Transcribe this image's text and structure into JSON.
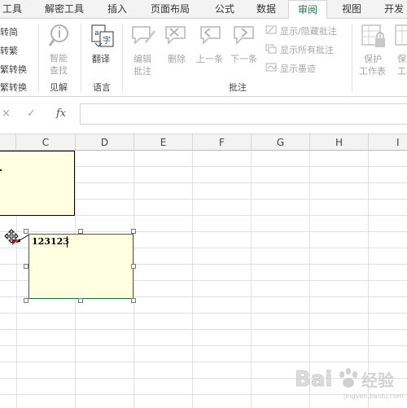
{
  "tabs": [
    {
      "label": "工具",
      "active": false
    },
    {
      "label": "解密工具",
      "active": false
    },
    {
      "label": "插入",
      "active": false
    },
    {
      "label": "页面布局",
      "active": false
    },
    {
      "label": "公式",
      "active": false
    },
    {
      "label": "数据",
      "active": false
    },
    {
      "label": "审阅",
      "active": true
    },
    {
      "label": "视图",
      "active": false
    },
    {
      "label": "开发",
      "active": false
    }
  ],
  "ribbon": {
    "chinese": {
      "trad_to_simp": "转简",
      "simp_to_trad": "转繁",
      "conversion": "繁转换",
      "group": "繁转换"
    },
    "insights": {
      "smart_lookup_line1": "智能",
      "smart_lookup_line2": "查找",
      "group": "见解"
    },
    "language": {
      "translate": "翻译",
      "group": "语言"
    },
    "comments": {
      "edit_line1": "编辑",
      "edit_line2": "批注",
      "delete": "删除",
      "previous": "上一条",
      "next": "下一条",
      "show_hide": "显示/隐藏批注",
      "show_all": "显示所有批注",
      "show_ink": "显示墨迹",
      "group": "批注"
    },
    "protect": {
      "protect_sheet_line1": "保护",
      "protect_sheet_line2": "工作表",
      "protect_workbook_line1": "保",
      "protect_workbook_line2": "工"
    }
  },
  "formula_bar": {
    "cancel": "×",
    "enter": "✓",
    "fx": "fx",
    "value": ""
  },
  "columns": [
    "C",
    "D",
    "E",
    "F",
    "G",
    "H",
    "I"
  ],
  "comments": [
    {
      "text": "",
      "partial_text": "."
    },
    {
      "text": "123123"
    }
  ],
  "watermark": {
    "line1": "Bai",
    "line2": "经验",
    "sub": "jingyan.baidu.com"
  },
  "colors": {
    "accent": "#217346",
    "comment_bg": "#ffffe1",
    "grid": "#e1e1e1"
  }
}
